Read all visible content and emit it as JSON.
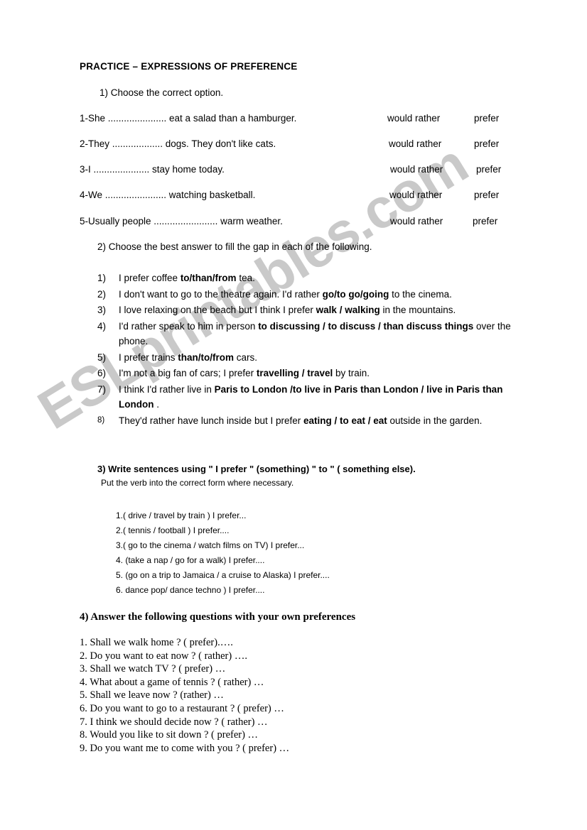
{
  "document": {
    "title": "PRACTICE – EXPRESSIONS OF PREFERENCE",
    "watermark": "ESLprintables.com",
    "watermark_color": "#c9c9c9"
  },
  "section1": {
    "heading": "1)  Choose the correct option.",
    "option_a": "would rather",
    "option_b": "prefer",
    "items": [
      "1-She ...................... eat a salad than a hamburger.",
      "2-They ................... dogs. They don't like cats.",
      "3-I .....................  stay home today.",
      "4-We ....................... watching basketball.",
      "5-Usually people ........................ warm weather."
    ]
  },
  "section2": {
    "heading": "2)  Choose the best answer to fill the gap in each of the following.",
    "items": [
      {
        "num": "1)",
        "pre": "I prefer coffee  ",
        "bold": "to/than/from",
        "post": "  tea."
      },
      {
        "num": "2)",
        "pre": "I don't want to go to the theatre again. I'd rather ",
        "bold": "go/to go/going",
        "post": "  to the cinema."
      },
      {
        "num": "3)",
        "pre": " I love relaxing on the beach but I think I prefer ",
        "bold": "walk / walking",
        "post": "  in the mountains."
      },
      {
        "num": "4)",
        "pre": " I'd rather speak to him in person  ",
        "bold": "to discussing / to discuss / than discuss things",
        "post": " over the phone."
      },
      {
        "num": "5)",
        "pre": " I prefer trains ",
        "bold": "than/to/from",
        "post": "  cars."
      },
      {
        "num": "6)",
        "pre": "I'm not a big fan of cars; I prefer ",
        "bold": "travelling / travel",
        "post": "  by train."
      },
      {
        "num": "7)",
        "pre": " I think I'd rather live in ",
        "bold": "Paris to London /to live in Paris than London / live in Paris than London",
        "post": "   ."
      },
      {
        "num": "8)",
        "pre": "They'd rather have lunch inside but I prefer ",
        "bold": "eating / to eat / eat",
        "post": "   outside in the garden."
      }
    ]
  },
  "section3": {
    "heading": "3) Write sentences using \" I prefer \" (something) \" to \" ( something else).",
    "subheading": "Put the verb into the correct form where necessary.",
    "items": [
      "1.( drive / travel by train ) I prefer...",
      "2.( tennis / football ) I prefer....",
      "3.( go to the cinema / watch films on TV) I prefer...",
      "4. (take a nap / go for a walk) I prefer....",
      "5. (go on a trip to Jamaica / a cruise to Alaska)  I prefer....",
      "6. dance pop/ dance techno ) I prefer...."
    ]
  },
  "section4": {
    "heading": "4) Answer the following questions with your own preferences",
    "items": [
      "1. Shall we walk home ? ( prefer).….",
      "2. Do you want to eat now ? ( rather) ….",
      "3. Shall we watch TV ? ( prefer) …",
      "4. What about a game of tennis ? ( rather) …",
      "5. Shall we leave now ? (rather) …",
      "6. Do you want to go to a restaurant ? ( prefer) …",
      "7. I think we should decide now ? ( rather) …",
      "8. Would you like to sit down ? ( prefer) …",
      "9. Do you want me to come with you ? ( prefer) …"
    ]
  }
}
